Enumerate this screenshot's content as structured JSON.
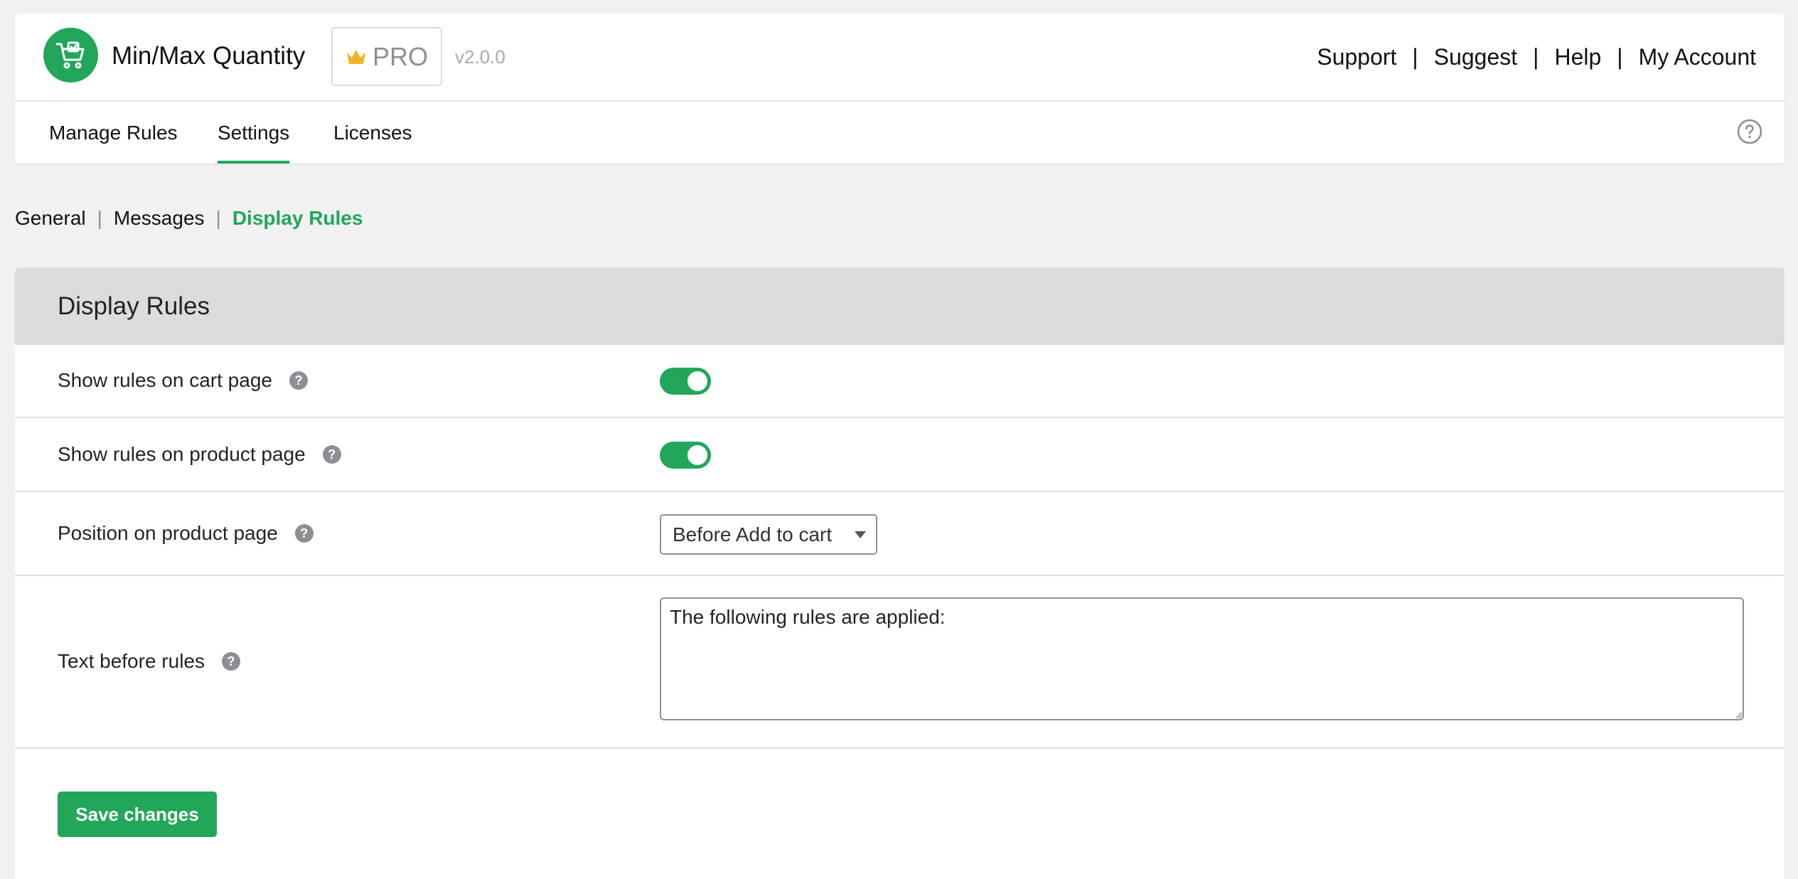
{
  "app": {
    "title": "Min/Max Quantity",
    "pro_label": "PRO",
    "version": "v2.0.0"
  },
  "top_links": [
    "Support",
    "Suggest",
    "Help",
    "My Account"
  ],
  "top_link_separator": "|",
  "tabs": [
    {
      "label": "Manage Rules",
      "active": false
    },
    {
      "label": "Settings",
      "active": true
    },
    {
      "label": "Licenses",
      "active": false
    }
  ],
  "subnav": {
    "items": [
      "General",
      "Messages",
      "Display Rules"
    ],
    "active": "Display Rules",
    "separator": "|"
  },
  "section": {
    "title": "Display Rules",
    "rows": [
      {
        "label": "Show rules on cart page",
        "control": "toggle",
        "value": true
      },
      {
        "label": "Show rules on product page",
        "control": "toggle",
        "value": true
      },
      {
        "label": "Position on product page",
        "control": "select",
        "value": "Before Add to cart"
      },
      {
        "label": "Text before rules",
        "control": "textarea",
        "value": "The following rules are applied:"
      }
    ],
    "save_label": "Save changes"
  },
  "colors": {
    "accent": "#21a65a",
    "pro_crown": "#f0b429",
    "header_band": "#dcdcdc",
    "page_bg": "#f1f1f1"
  },
  "icons": {
    "logo": "cart-icon",
    "pro": "crown-icon",
    "help": "question-circle-icon",
    "row_help": "question-icon"
  }
}
